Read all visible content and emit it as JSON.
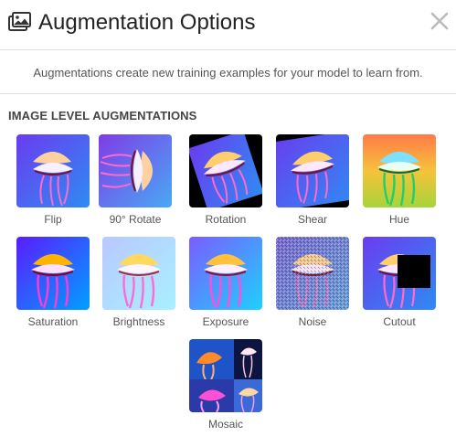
{
  "header": {
    "title": "Augmentation Options",
    "icon": "image-gallery-icon",
    "close_icon": "close-icon"
  },
  "description": "Augmentations create new training examples for your model to learn from.",
  "section": {
    "title": "IMAGE LEVEL AUGMENTATIONS"
  },
  "augmentations": [
    {
      "label": "Flip"
    },
    {
      "label": "90° Rotate"
    },
    {
      "label": "Rotation"
    },
    {
      "label": "Shear"
    },
    {
      "label": "Hue"
    },
    {
      "label": "Saturation"
    },
    {
      "label": "Brightness"
    },
    {
      "label": "Exposure"
    },
    {
      "label": "Noise"
    },
    {
      "label": "Cutout"
    },
    {
      "label": "Mosaic"
    }
  ],
  "colors": {
    "title_text": "#222222",
    "description_text": "#555555",
    "divider": "#e3e3e3",
    "close_icon": "#bbbbbb"
  }
}
